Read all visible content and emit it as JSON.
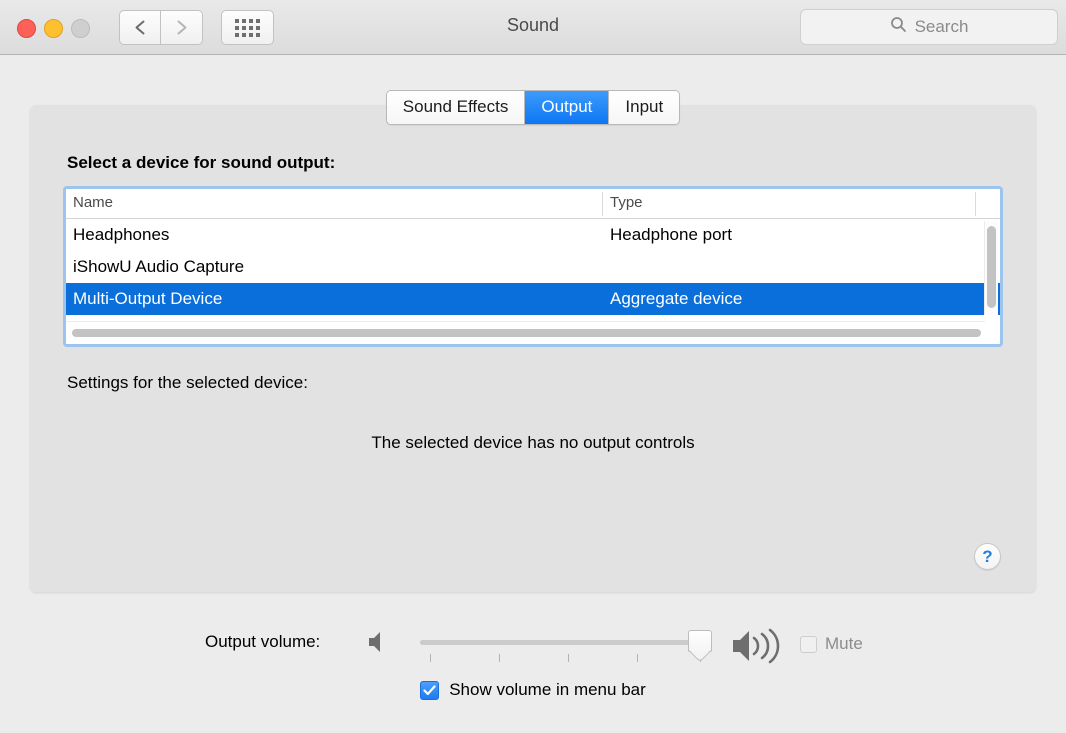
{
  "window": {
    "title": "Sound",
    "traffic_lights": [
      "close",
      "minimize",
      "zoom"
    ],
    "nav_back_icon": "chevron-left-icon",
    "nav_forward_icon": "chevron-right-icon",
    "grid_icon": "show-all-grid-icon"
  },
  "search": {
    "placeholder": "Search",
    "icon": "search-icon",
    "value": ""
  },
  "tabs": [
    {
      "label": "Sound Effects",
      "selected": false
    },
    {
      "label": "Output",
      "selected": true
    },
    {
      "label": "Input",
      "selected": false
    }
  ],
  "main": {
    "section_title": "Select a device for sound output:",
    "settings_label": "Settings for the selected device:",
    "no_controls_message": "The selected device has no output controls",
    "help_label": "?"
  },
  "device_table": {
    "columns": [
      "Name",
      "Type"
    ],
    "rows": [
      {
        "name": "Headphones",
        "type": "Headphone port",
        "selected": false
      },
      {
        "name": "iShowU Audio Capture",
        "type": "",
        "selected": false
      },
      {
        "name": "Multi-Output Device",
        "type": "Aggregate device",
        "selected": true
      }
    ]
  },
  "volume": {
    "label": "Output volume:",
    "min_icon": "speaker-low-icon",
    "max_icon": "speaker-high-icon",
    "slider_value": 100,
    "slider_min": 0,
    "slider_max": 100,
    "tick_count": 5,
    "mute_label": "Mute",
    "mute_checked": false,
    "show_in_menu_bar_label": "Show volume in menu bar",
    "show_in_menu_bar_checked": true,
    "checkmark": "✓"
  },
  "colors": {
    "accent_blue": "#0a6fdb",
    "tab_selected": "#1d7cf2",
    "focus_ring": "#9dc4ee",
    "window_bg": "#ececec",
    "card_bg": "#e2e2e2"
  }
}
